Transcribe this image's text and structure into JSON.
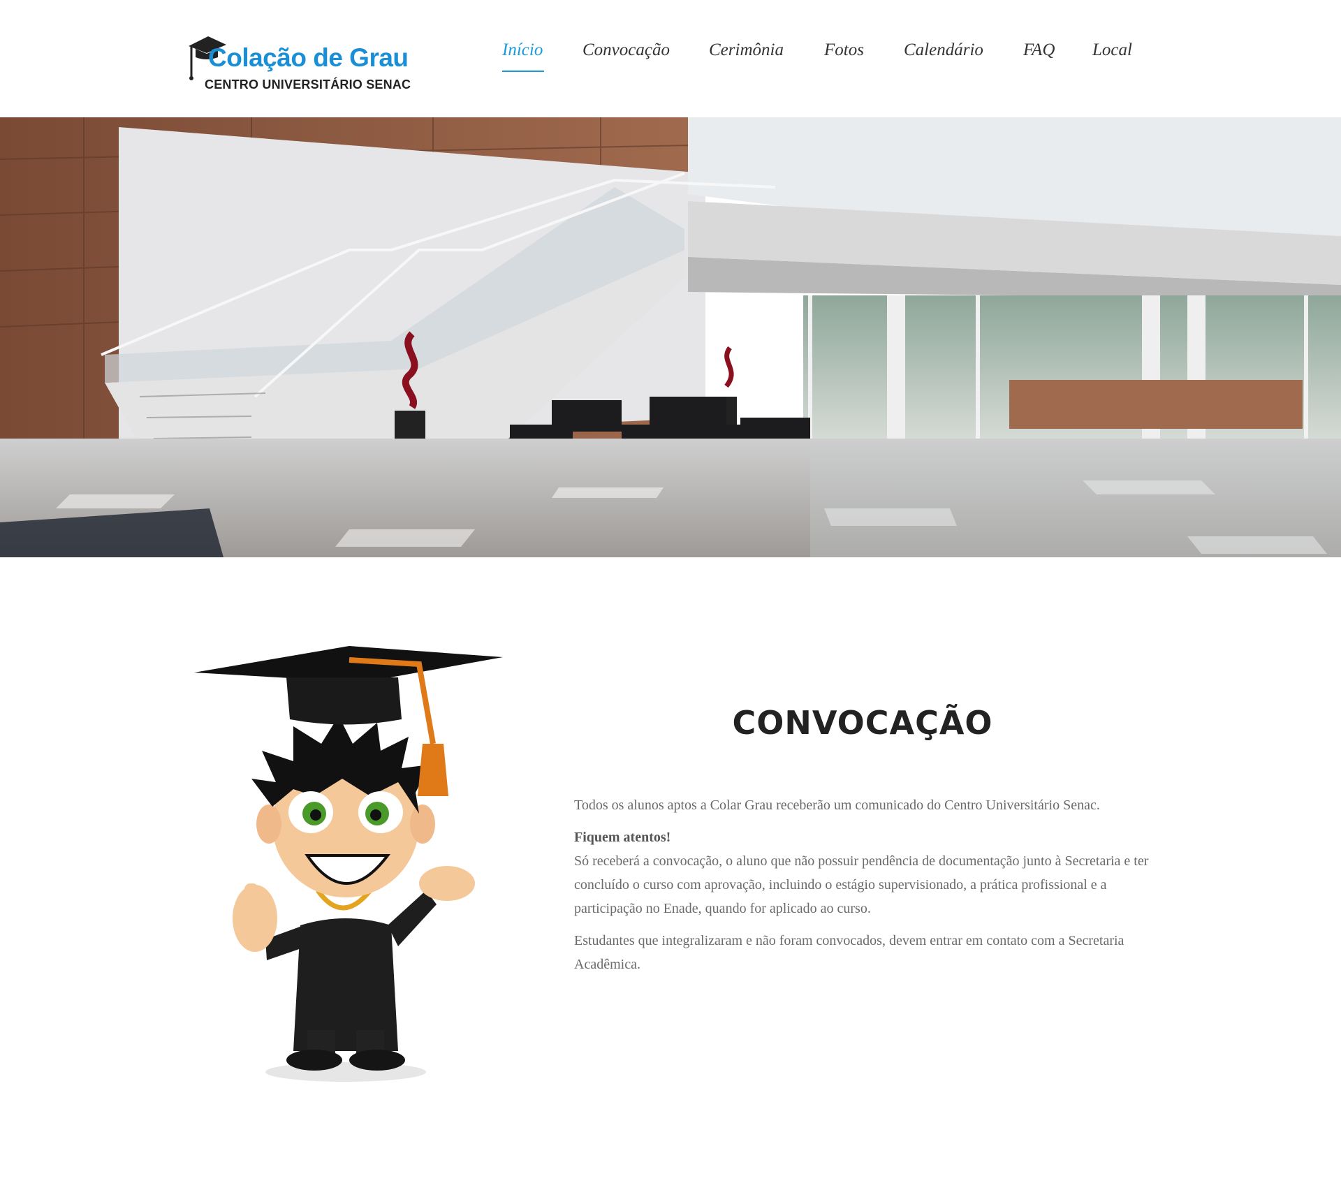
{
  "logo": {
    "title": "Colação de Grau",
    "subtitle": "CENTRO UNIVERSITÁRIO SENAC"
  },
  "nav": {
    "items": [
      {
        "label": "Início",
        "active": true
      },
      {
        "label": "Convocação",
        "active": false
      },
      {
        "label": "Cerimônia",
        "active": false
      },
      {
        "label": "Fotos",
        "active": false
      },
      {
        "label": "Calendário",
        "active": false
      },
      {
        "label": "FAQ",
        "active": false
      },
      {
        "label": "Local",
        "active": false
      }
    ]
  },
  "section": {
    "title": "CONVOCAÇÃO",
    "paragraph1": "Todos os alunos aptos a Colar Grau receberão um comunicado do Centro Universitário Senac.",
    "attention": "Fiquem atentos!",
    "paragraph2": "Só receberá a convocação, o aluno que não possuir pendência de documentação junto à Secretaria e ter concluído o curso com aprovação, incluindo o estágio supervisionado, a prática profissional e a participação no Enade, quando for aplicado ao curso.",
    "paragraph3": "Estudantes que integralizaram e não foram convocados, devem entrar em contato com a Secretaria Acadêmica."
  },
  "colors": {
    "accent": "#1a9ad9",
    "logo_blue": "#1a8fd6",
    "heading": "#222222",
    "body_text": "#6a6a6a"
  },
  "icons": {
    "logo": "graduation-cap-icon",
    "mascot": "graduate-mascot-illustration"
  }
}
